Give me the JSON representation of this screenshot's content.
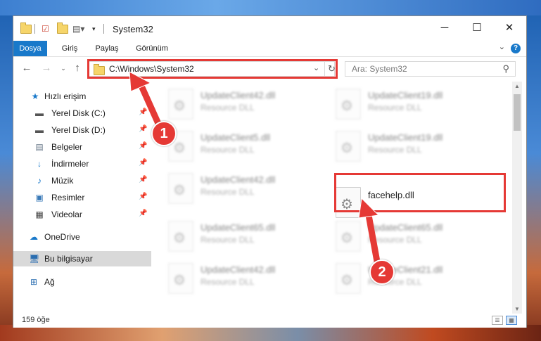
{
  "window": {
    "title": "System32"
  },
  "ribbon": {
    "tabs": [
      "Dosya",
      "Giriş",
      "Paylaş",
      "Görünüm"
    ],
    "help": "?"
  },
  "address": {
    "path": "C:\\Windows\\System32"
  },
  "search": {
    "placeholder": "Ara: System32"
  },
  "sidebar": {
    "items": [
      {
        "label": "Hızlı erişim",
        "icon": "star-icon"
      },
      {
        "label": "Yerel Disk (C:)",
        "icon": "drive-icon",
        "pinned": true
      },
      {
        "label": "Yerel Disk (D:)",
        "icon": "drive-icon",
        "pinned": true
      },
      {
        "label": "Belgeler",
        "icon": "documents-icon",
        "pinned": true
      },
      {
        "label": "İndirmeler",
        "icon": "download-icon",
        "pinned": true
      },
      {
        "label": "Müzik",
        "icon": "music-icon",
        "pinned": true
      },
      {
        "label": "Resimler",
        "icon": "pictures-icon",
        "pinned": true
      },
      {
        "label": "Videolar",
        "icon": "video-icon",
        "pinned": true
      },
      {
        "label": "OneDrive",
        "icon": "cloud-icon"
      },
      {
        "label": "Bu bilgisayar",
        "icon": "computer-icon",
        "selected": true
      },
      {
        "label": "Ağ",
        "icon": "network-icon"
      }
    ]
  },
  "files": [
    {
      "name": "UpdateClient42.dll",
      "type": "Resource DLL"
    },
    {
      "name": "UpdateClient19.dll",
      "type": "Resource DLL"
    },
    {
      "name": "UpdateClient5.dll",
      "type": "Resource DLL"
    },
    {
      "name": "UpdateClient19.dll",
      "type": "Resource DLL"
    },
    {
      "name": "UpdateClient42.dll",
      "type": "Resource DLL"
    },
    {
      "name": "facehelp.dll",
      "type": ""
    },
    {
      "name": "UpdateClient65.dll",
      "type": "Resource DLL"
    },
    {
      "name": "UpdateClient65.dll",
      "type": "Resource DLL"
    },
    {
      "name": "UpdateClient42.dll",
      "type": "Resource DLL"
    },
    {
      "name": "UpdateClient21.dll",
      "type": "Resource DLL"
    }
  ],
  "status": {
    "count": "159 öğe"
  },
  "callouts": [
    "1",
    "2"
  ],
  "colors": {
    "accent": "#1979ca",
    "highlight": "#e53935"
  }
}
